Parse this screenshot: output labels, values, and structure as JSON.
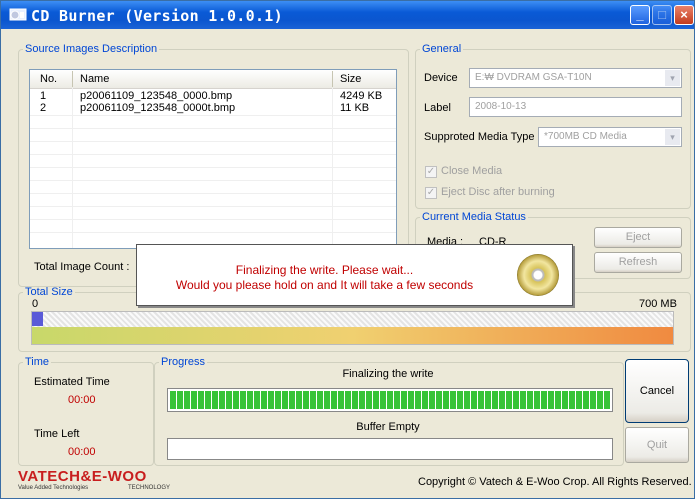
{
  "window": {
    "title": "CD Burner (Version 1.0.0.1)"
  },
  "source": {
    "legend": "Source Images Description",
    "columns": [
      "No.",
      "Name",
      "Size"
    ],
    "rows": [
      {
        "no": "1",
        "name": "p20061109_123548_0000.bmp",
        "size": "4249 KB"
      },
      {
        "no": "2",
        "name": "p20061109_123548_0000t.bmp",
        "size": "11 KB"
      }
    ],
    "total_count_label": "Total Image Count :"
  },
  "general": {
    "legend": "General",
    "device_label": "Device",
    "device_value": "E:₩ DVDRAM GSA-T10N",
    "label_label": "Label",
    "label_value": "2008-10-13",
    "media_type_label": "Supproted Media Type",
    "media_type_value": "*700MB CD Media",
    "close_media": "Close Media",
    "eject_disc": "Eject Disc after burning"
  },
  "media_status": {
    "legend": "Current Media Status",
    "media_label": "Media :",
    "media_value": "CD-R",
    "eject": "Eject",
    "refresh": "Refresh"
  },
  "popup": {
    "line1": "Finalizing the write. Please wait...",
    "line2": "Would you please hold on and It will take a few seconds"
  },
  "total_size": {
    "legend": "Total Size",
    "min": "0",
    "max": "700 MB",
    "used_fraction": 0.017
  },
  "time": {
    "legend": "Time",
    "estimated_label": "Estimated Time",
    "estimated_value": "00:00",
    "left_label": "Time Left",
    "left_value": "00:00"
  },
  "progress": {
    "legend": "Progress",
    "status": "Finalizing the write",
    "write_fraction": 1.0,
    "buffer_label": "Buffer Empty",
    "buffer_fraction": 0.0
  },
  "buttons": {
    "cancel": "Cancel",
    "quit": "Quit"
  },
  "footer": {
    "logo_main": "VATECH&E-WOO",
    "logo_sub1": "Value Added Technologies",
    "logo_sub2": "TECHNOLOGY",
    "copyright": "Copyright © Vatech & E-Woo Crop. All Rights Reserved."
  },
  "colors": {
    "legend": "#0046d5",
    "time_value": "#c00000",
    "popup_text": "#c00000",
    "progress": "#37c337"
  }
}
